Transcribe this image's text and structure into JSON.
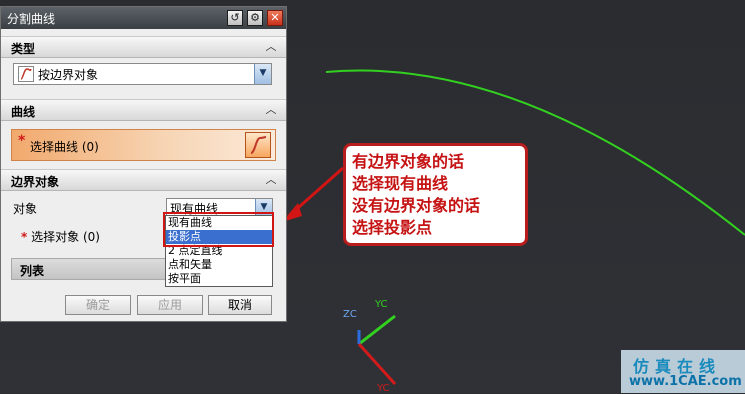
{
  "dialog": {
    "title": "分割曲线",
    "type_section": {
      "label": "类型",
      "selected": "按边界对象"
    },
    "curve_section": {
      "label": "曲线",
      "select_label": "选择曲线",
      "select_count": "(0)"
    },
    "boundary_section": {
      "label": "边界对象",
      "object_label": "对象",
      "object_value": "现有曲线",
      "select_label": "选择对象",
      "select_count": "(0)",
      "list_label": "列表"
    },
    "buttons": {
      "ok": "确定",
      "apply": "应用",
      "cancel": "取消"
    }
  },
  "dropdown_options": [
    {
      "label": "现有曲线",
      "selected": false
    },
    {
      "label": "投影点",
      "selected": true
    },
    {
      "label": "2 点定直线",
      "selected": false
    },
    {
      "label": "点和矢量",
      "selected": false
    },
    {
      "label": "按平面",
      "selected": false
    }
  ],
  "callout": {
    "lines": [
      "有边界对象的话",
      "选择现有曲线",
      "没有边界对象的话",
      "选择投影点"
    ]
  },
  "axes": {
    "zc": "ZC",
    "yc": "YC",
    "yc_bottom": "YC"
  },
  "watermark": {
    "line1": "仿真在线",
    "line2": "www.1CAE.com"
  },
  "colors": {
    "accent_red": "#d11414",
    "curve_green": "#33d11f",
    "highlight_blue": "#3a6fd0"
  },
  "icons": {
    "close": "close-icon",
    "settings": "gear-icon",
    "reset": "reset-icon"
  }
}
